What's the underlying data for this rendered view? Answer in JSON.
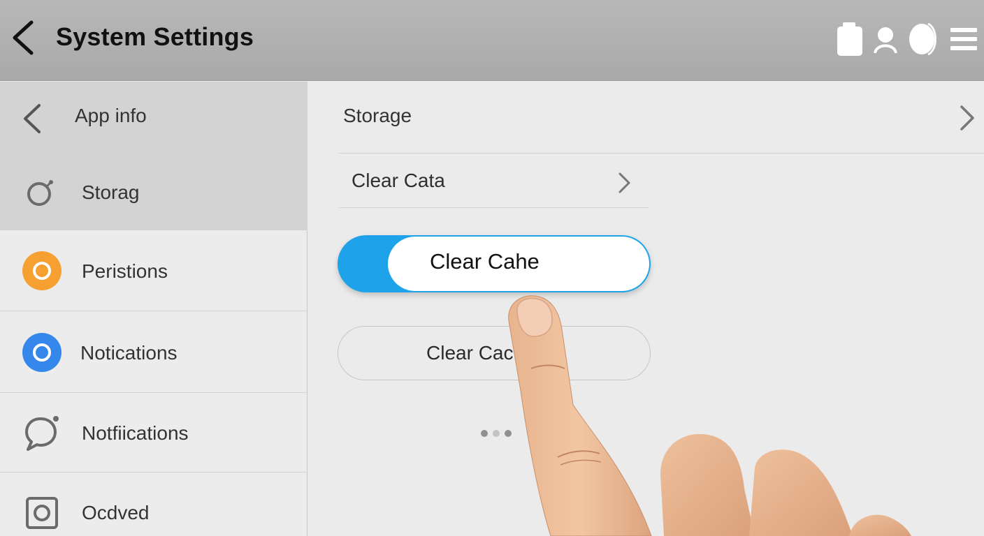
{
  "header": {
    "title": "System Settings",
    "icons": [
      "battery-icon",
      "account-icon",
      "profile-icon",
      "menu-icon"
    ]
  },
  "sidebar": {
    "header_label": "App info",
    "items": [
      {
        "label": "Storag",
        "icon": "storage-icon",
        "selected": true
      },
      {
        "label": "Peristions",
        "icon": "permissions-icon",
        "color": "#f5a031"
      },
      {
        "label": "Notications",
        "icon": "notifications-icon",
        "color": "#3587ec"
      },
      {
        "label": "Notfiications",
        "icon": "chat-bubble-icon"
      },
      {
        "label": "Ocdved",
        "icon": "square-ring-icon"
      }
    ]
  },
  "main": {
    "storage_label": "Storage",
    "clear_data_label": "Clear Cata",
    "clear_cache_toggle_label": "Clear Cahe",
    "clear_cache_button_label": "Clear Cac",
    "accent_color": "#1ea3ea"
  }
}
